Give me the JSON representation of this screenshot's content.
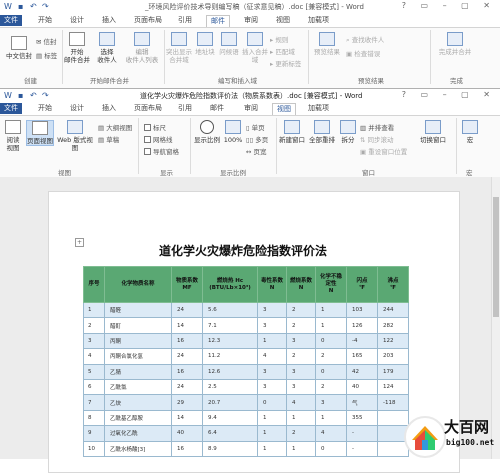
{
  "back_window": {
    "title": "_环境风险评价技术导则编写稿（征求意见稿）.doc [兼容模式] - Word",
    "tabs": [
      "文件",
      "开始",
      "设计",
      "插入",
      "页面布局",
      "引用",
      "邮件",
      "审阅",
      "视图",
      "加载项"
    ],
    "active_tab": "邮件",
    "groups": {
      "create": {
        "label": "创建",
        "items": [
          "中文信封",
          "信封",
          "标签"
        ]
      },
      "start_merge": {
        "label": "开始邮件合并",
        "items": [
          "开始\n邮件合并",
          "选择\n收件人",
          "编辑\n收件人列表"
        ]
      },
      "write_insert": {
        "label": "编写和插入域",
        "items": [
          "突出显示\n合并域",
          "地址块",
          "问候语",
          "插入合并域",
          "规则",
          "匹配域",
          "更新标签"
        ]
      },
      "preview": {
        "label": "预览结果",
        "items": [
          "预览结果",
          "查找收件人",
          "检查错误"
        ]
      },
      "finish": {
        "label": "完成",
        "items": [
          "完成并合并"
        ]
      }
    }
  },
  "front_window": {
    "title": "道化学火灾爆炸危险指数评价法（物质系数表）.doc [兼容模式] - Word",
    "tabs": [
      "文件",
      "开始",
      "设计",
      "插入",
      "页面布局",
      "引用",
      "邮件",
      "审阅",
      "视图",
      "加载项"
    ],
    "active_tab": "视图",
    "groups": {
      "views": {
        "label": "视图",
        "items": [
          "阅读\n视图",
          "页面视图",
          "Web 版式视图",
          "大纲视图",
          "草稿"
        ]
      },
      "show": {
        "label": "显示",
        "items": [
          "标尺",
          "网格线",
          "导航窗格"
        ]
      },
      "zoom": {
        "label": "显示比例",
        "items": [
          "显示比例",
          "100%",
          "单页",
          "多页",
          "页宽"
        ]
      },
      "window": {
        "label": "窗口",
        "items": [
          "新建窗口",
          "全部重排",
          "拆分",
          "并排查看",
          "同步滚动",
          "重设窗口位置",
          "切换窗口"
        ]
      },
      "macro": {
        "label": "宏",
        "items": [
          "宏"
        ]
      }
    }
  },
  "document": {
    "title": "道化学火灾爆炸危险指数评价法",
    "table": {
      "headers": [
        "序号",
        "化学物质名称",
        "物质系数\nMF",
        "燃烧热 Hc\n(BTU/Lb×10³)",
        "毒性系数\nN",
        "燃烧系数\nN",
        "化学不稳\n定性\nN",
        "闪点\n℉",
        "沸点\n℉"
      ],
      "rows": [
        [
          "1",
          "醋醛",
          "24",
          "5.6",
          "3",
          "2",
          "1",
          "103",
          "244"
        ],
        [
          "2",
          "醋酊",
          "14",
          "7.1",
          "3",
          "2",
          "1",
          "126",
          "282"
        ],
        [
          "3",
          "丙酮",
          "16",
          "12.3",
          "1",
          "3",
          "0",
          "-4",
          "122"
        ],
        [
          "4",
          "丙酮合氯化氢",
          "24",
          "11.2",
          "4",
          "2",
          "2",
          "165",
          "203"
        ],
        [
          "5",
          "乙腈",
          "16",
          "12.6",
          "3",
          "3",
          "0",
          "42",
          "179"
        ],
        [
          "6",
          "乙酰氯",
          "24",
          "2.5",
          "3",
          "3",
          "2",
          "40",
          "124"
        ],
        [
          "7",
          "乙炔",
          "29",
          "20.7",
          "0",
          "4",
          "3",
          "气",
          "-118"
        ],
        [
          "8",
          "乙酰基乙醇胺",
          "14",
          "9.4",
          "1",
          "1",
          "1",
          "355",
          ""
        ],
        [
          "9",
          "过氧化乙酰",
          "40",
          "6.4",
          "1",
          "2",
          "4",
          "-",
          ""
        ],
        [
          "10",
          "乙酰水杨酸[3]",
          "16",
          "8.9",
          "1",
          "1",
          "0",
          "-",
          ""
        ]
      ]
    }
  },
  "watermark": {
    "name": "大百网",
    "url": "big100.net"
  }
}
